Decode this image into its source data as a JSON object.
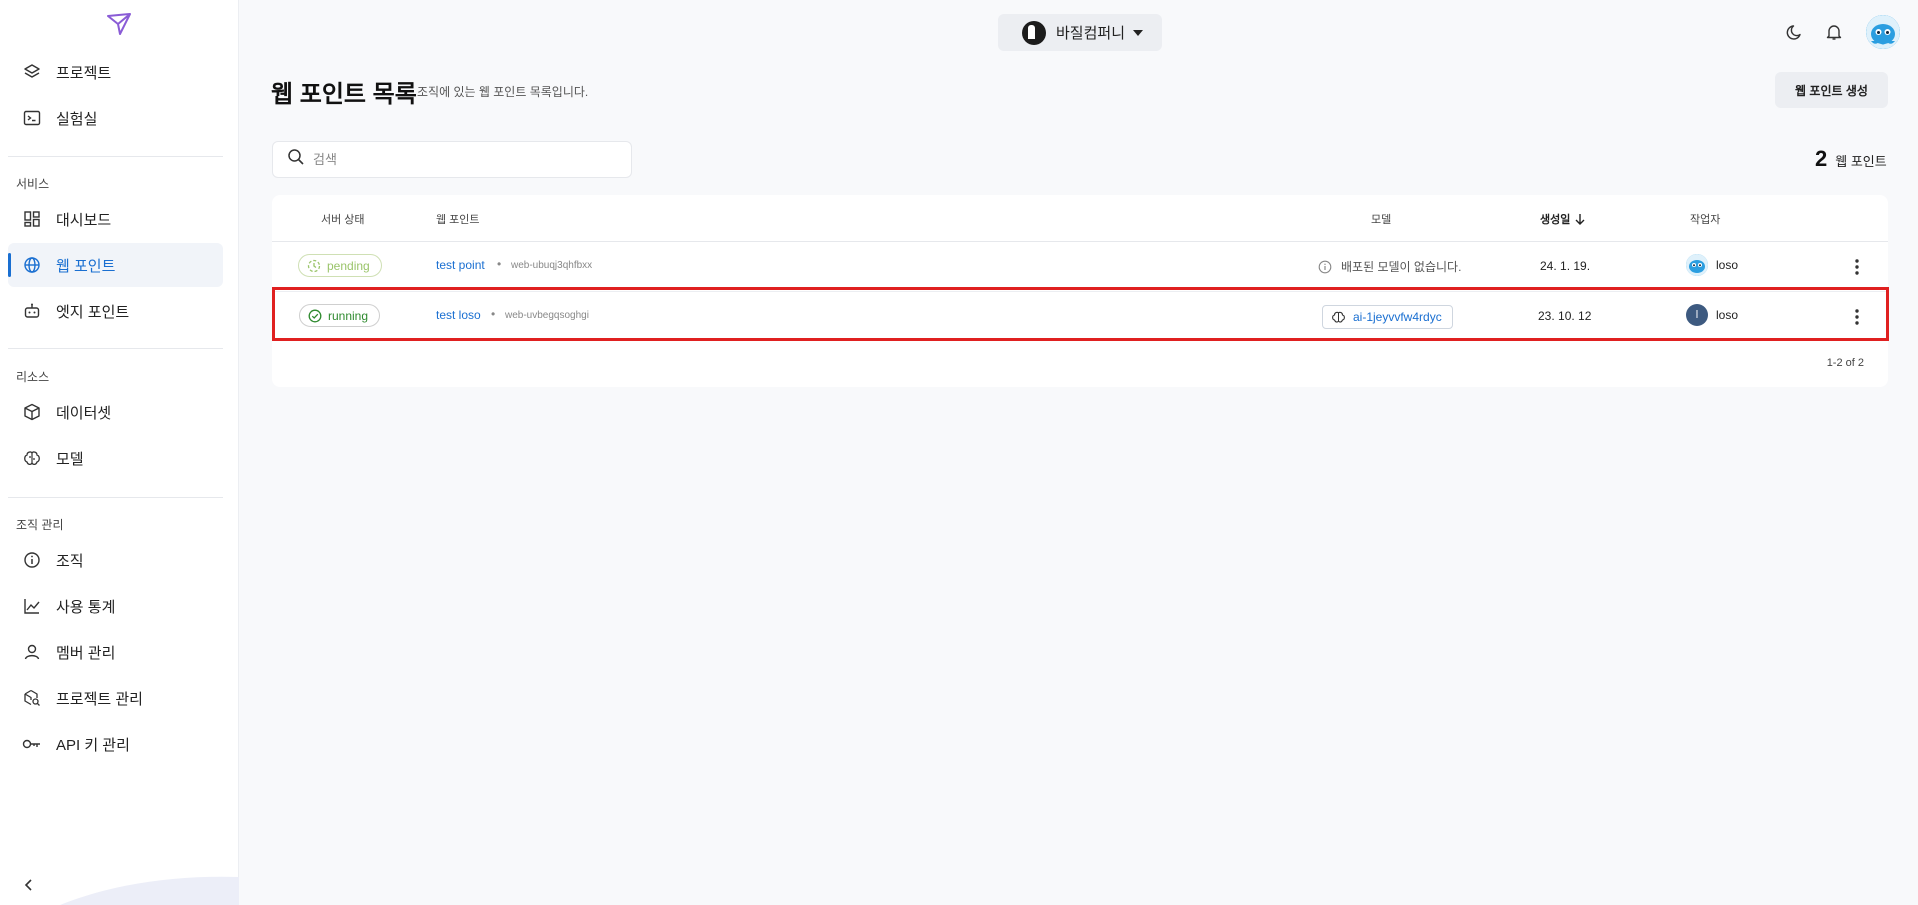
{
  "sidebar": {
    "items_top": [
      {
        "label": "프로젝트",
        "icon": "layers-icon"
      },
      {
        "label": "실험실",
        "icon": "terminal-icon"
      }
    ],
    "sections": [
      {
        "title": "서비스",
        "items": [
          {
            "label": "대시보드",
            "icon": "dashboard-icon"
          },
          {
            "label": "웹 포인트",
            "icon": "globe-icon",
            "active": true
          },
          {
            "label": "엣지 포인트",
            "icon": "robot-icon"
          }
        ]
      },
      {
        "title": "리소스",
        "items": [
          {
            "label": "데이터셋",
            "icon": "box-icon"
          },
          {
            "label": "모델",
            "icon": "brain-icon"
          }
        ]
      },
      {
        "title": "조직 관리",
        "items": [
          {
            "label": "조직",
            "icon": "info-icon"
          },
          {
            "label": "사용 통계",
            "icon": "chart-line-icon"
          },
          {
            "label": "멤버 관리",
            "icon": "user-icon"
          },
          {
            "label": "프로젝트 관리",
            "icon": "project-search-icon"
          },
          {
            "label": "API 키 관리",
            "icon": "key-icon"
          }
        ]
      }
    ]
  },
  "topbar": {
    "org_name": "바질컴퍼니"
  },
  "header": {
    "title": "웹 포인트 목록",
    "subtitle": "조직에 있는 웹 포인트 목록입니다.",
    "create_button": "웹 포인트 생성"
  },
  "search": {
    "placeholder": "검색"
  },
  "count": {
    "value": "2",
    "label": "웹 포인트"
  },
  "table": {
    "columns": {
      "status": "서버 상태",
      "endpoint": "웹 포인트",
      "model": "모델",
      "created": "생성일",
      "author": "작업자"
    },
    "rows": [
      {
        "status": "pending",
        "name": "test point",
        "id": "web-ubuqj3qhfbxx",
        "model_empty": "배포된 모델이 없습니다.",
        "created": "24. 1. 19.",
        "author": "loso"
      },
      {
        "status": "running",
        "name": "test loso",
        "id": "web-uvbegqsoghgi",
        "model": "ai-1jeyvvfw4rdyc",
        "created": "23. 10. 12",
        "author": "loso",
        "author_initial": "l"
      }
    ],
    "pagination": "1-2 of 2"
  },
  "colors": {
    "accent": "#1a6fd1",
    "pending": "#9ac46a",
    "running": "#2f8a2f",
    "highlight": "#e02020"
  }
}
